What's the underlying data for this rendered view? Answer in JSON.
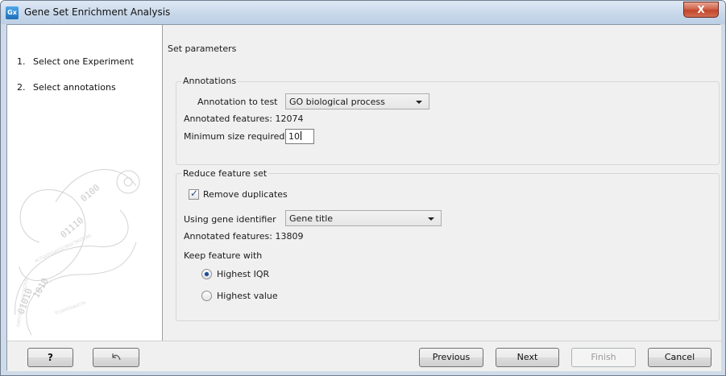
{
  "window": {
    "title": "Gene Set Enrichment Analysis",
    "app_icon_text": "Gx",
    "close_glyph": "X"
  },
  "steps": [
    {
      "number": "1.",
      "label": "Select one Experiment"
    },
    {
      "number": "2.",
      "label": "Select annotations"
    }
  ],
  "panel": {
    "heading": "Set parameters",
    "annotations": {
      "legend": "Annotations",
      "annotation_to_test_label": "Annotation to test",
      "annotation_to_test_value": "GO biological process",
      "annotated_features_label": "Annotated features:",
      "annotated_features_value": "12074",
      "minimum_size_label": "Minimum size required",
      "minimum_size_value": "10"
    },
    "reduce": {
      "legend": "Reduce feature set",
      "remove_duplicates_label": "Remove duplicates",
      "remove_duplicates_checked": true,
      "gene_identifier_label": "Using gene identifier",
      "gene_identifier_value": "Gene title",
      "annotated_features_label": "Annotated features:",
      "annotated_features_value": "13809",
      "keep_feature_label": "Keep feature with",
      "keep_options": [
        {
          "label": "Highest IQR",
          "selected": true
        },
        {
          "label": "Highest value",
          "selected": false
        }
      ]
    }
  },
  "buttons": {
    "help": "?",
    "previous": "Previous",
    "next": "Next",
    "finish": "Finish",
    "cancel": "Cancel"
  },
  "icons": {
    "help_button": "question-mark",
    "reset_button": "undo-arrow-icon",
    "logo": "swirl-binary-logo"
  }
}
